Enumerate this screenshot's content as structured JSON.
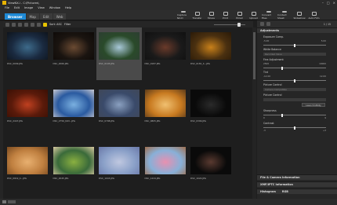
{
  "window": {
    "title": "ViewNX-i - C:\\Pictures\\"
  },
  "menu": [
    "File",
    "Edit",
    "Image",
    "View",
    "Window",
    "Help"
  ],
  "tabs": [
    {
      "label": "Browser",
      "active": true
    },
    {
      "label": "Map"
    },
    {
      "label": "Edit"
    },
    {
      "label": "Web"
    }
  ],
  "toolbar_tools": [
    "Capture NX-D",
    "Transfer",
    "Movie",
    "Print",
    "Email",
    "Upload",
    "Convert Files",
    "Contact Sheet",
    "Slideshow",
    "Auto Film"
  ],
  "gridbar": {
    "sort": "Sort: ASC",
    "filter": "Filter"
  },
  "thumbnails": [
    {
      "caption": "DSC_0009.JPG",
      "colors": [
        "#1a2a40",
        "#3d6a8a",
        "#0e141c"
      ]
    },
    {
      "caption": "DSC_2066.JPG",
      "colors": [
        "#1a1410",
        "#6a4a32",
        "#0e0a08"
      ]
    },
    {
      "caption": "DSC_0193.JPG",
      "colors": [
        "#2a4a2a",
        "#a8c8d8",
        "#2d3e32"
      ],
      "selected": true
    },
    {
      "caption": "DSC_0187.JPG",
      "colors": [
        "#1a1a1a",
        "#6a3a2a",
        "#101010"
      ]
    },
    {
      "caption": "DSC_0181_4...JPG",
      "colors": [
        "#4a3010",
        "#c8801a",
        "#2a1a08"
      ]
    },
    {
      "caption": "DSC_2447.JPG",
      "colors": [
        "#5a1a0a",
        "#c04020",
        "#3a1005"
      ]
    },
    {
      "caption": "DSC_2756_KOV...JPG",
      "colors": [
        "#2a5aa0",
        "#7ab0e0",
        "#c8c8d0"
      ]
    },
    {
      "caption": "DSC_0798.JPG",
      "colors": [
        "#3a4a6a",
        "#8aa0c0",
        "#404858"
      ]
    },
    {
      "caption": "DSC_0805.JPG",
      "colors": [
        "#c87a20",
        "#f0c070",
        "#5a3a1a"
      ]
    },
    {
      "caption": "DSC_0309.JPG",
      "colors": [
        "#0a0a0a",
        "#2a2a2a",
        "#0a0a0a"
      ]
    },
    {
      "caption": "DSC_0919_4...JPG",
      "colors": [
        "#c08040",
        "#e8b070",
        "#7a4a20"
      ]
    },
    {
      "caption": "DSC_2045.JPG",
      "colors": [
        "#3a6a3a",
        "#8ab040",
        "#d8c8a0"
      ]
    },
    {
      "caption": "DSC_1043.JPG",
      "colors": [
        "#8aa0c8",
        "#c0c8e0",
        "#6a78a8"
      ]
    },
    {
      "caption": "DSC_1224.JPG",
      "colors": [
        "#88b0d8",
        "#e890b0",
        "#a07050"
      ]
    },
    {
      "caption": "DSC_1022.JPG",
      "colors": [
        "#0a0a0a",
        "#5a3a30",
        "#0a0a0a"
      ]
    }
  ],
  "panel": {
    "page_indicator": "1 / 15",
    "sections": {
      "adjustments": "Adjustments",
      "file_camera": "File & Camera Information",
      "xmp_iptc": "XMP/IPTC Information",
      "histogram": "Histogram",
      "histogram_mode": "RGB"
    },
    "exposure": {
      "label": "Exposure Comp.",
      "min": "-5.00",
      "max": "5.00",
      "value": "0.00",
      "fraction": 0.5
    },
    "white_balance": {
      "label": "White Balance",
      "value": "Recorded Value"
    },
    "fine_adj": {
      "label": "Fine Adjustment",
      "min": "2500",
      "max": "10000",
      "fraction": 0.3
    },
    "tint": {
      "label": "Tint",
      "min": "-12.00",
      "max": "12.00",
      "fraction": 0.5
    },
    "picture_control": {
      "label": "Picture Control",
      "value": "Camera Compatible",
      "sub": "Picture Control",
      "button": "Launch Utility"
    },
    "sharpness": {
      "label": "Sharpness",
      "min": "0",
      "max": "9",
      "fraction": 0.3
    },
    "contrast": {
      "label": "Contrast",
      "min": "-3",
      "max": "+3",
      "fraction": 0.5
    }
  }
}
